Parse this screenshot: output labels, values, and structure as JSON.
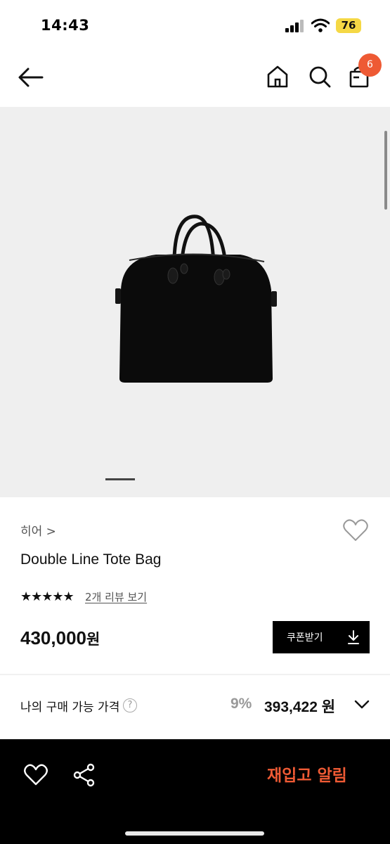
{
  "status_bar": {
    "time": "14:43",
    "battery": "76"
  },
  "nav": {
    "cart_count": "6"
  },
  "product": {
    "brand": "히어 >",
    "name": "Double Line Tote Bag",
    "rating_stars": "★★★★★",
    "review_link": "2개 리뷰 보기",
    "price": "430,000",
    "price_unit": "원",
    "coupon_label": "쿠폰받기"
  },
  "buy_price": {
    "label": "나의 구매 가능 가격",
    "help": "?",
    "discount": "9%",
    "price": "393,422 원"
  },
  "bottom_bar": {
    "restock_label": "재입고 알림"
  },
  "colors": {
    "accent": "#ee5a34",
    "bottom_bar": "#000000"
  },
  "icons": [
    "back-arrow-icon",
    "home-icon",
    "search-icon",
    "shopping-bag-icon",
    "heart-icon",
    "share-icon",
    "download-icon",
    "chevron-down-icon",
    "help-icon"
  ]
}
